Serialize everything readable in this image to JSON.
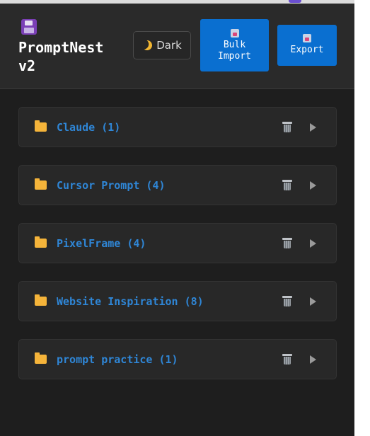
{
  "app": {
    "title_line1": "PromptNest",
    "title_line2": "v2"
  },
  "header": {
    "theme_button_label": "Dark",
    "bulk_import_line1": "Bulk",
    "bulk_import_line2": "Import",
    "export_label": "Export"
  },
  "icons": {
    "logo": "floppy-disk-icon",
    "theme": "crescent-moon-icon",
    "folder": "folder-icon",
    "delete": "trash-can-icon",
    "expand": "chevron-right-icon"
  },
  "colors": {
    "accent": "#0a6fd0",
    "folder_text": "#2f86d6",
    "folder_icon": "#f5b43a",
    "background": "#1e1e1e"
  },
  "folders": [
    {
      "label": "Claude (1)"
    },
    {
      "label": "Cursor Prompt (4)"
    },
    {
      "label": "PixelFrame (4)"
    },
    {
      "label": "Website Inspiration (8)"
    },
    {
      "label": "prompt practice (1)"
    }
  ]
}
